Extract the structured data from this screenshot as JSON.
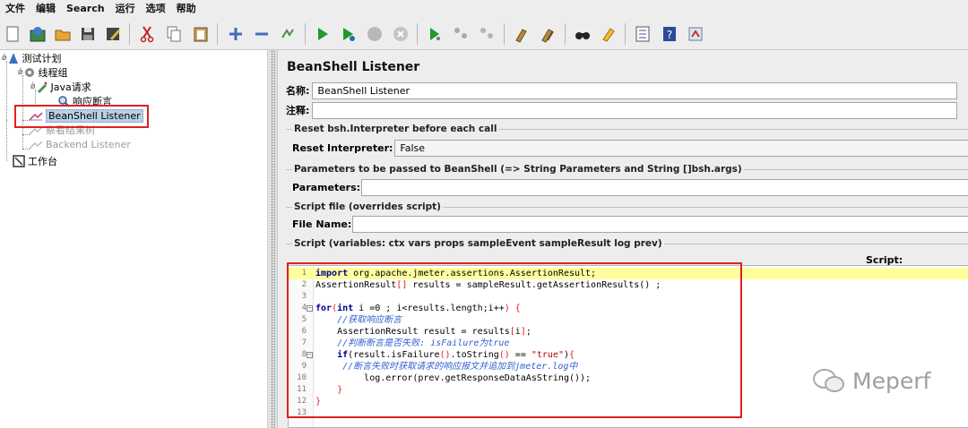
{
  "menu": [
    "文件",
    "编辑",
    "Search",
    "运行",
    "选项",
    "帮助"
  ],
  "toolbar_icons": [
    "new-icon",
    "templates-icon",
    "open-icon",
    "save-icon",
    "save-as-icon",
    "cut-icon",
    "copy-icon",
    "paste-icon",
    "expand-icon",
    "collapse-icon",
    "toggle-icon",
    "start-icon",
    "start-no-pause-icon",
    "stop-icon",
    "shutdown-icon",
    "remote-start-icon",
    "remote-stop-icon",
    "remote-shutdown-icon",
    "clear-icon",
    "clear-all-icon",
    "search-icon",
    "reset-search-icon",
    "function-helper-icon",
    "help-icon",
    "ssl-manager-icon"
  ],
  "tree": {
    "test_plan": "测试计划",
    "thread_group": "线程组",
    "java_request": "Java请求",
    "response_assertion": "响应断言",
    "beanshell_listener": "BeanShell Listener",
    "view_results": "察看结果树",
    "backend_listener": "Backend Listener",
    "workbench": "工作台"
  },
  "panel": {
    "title": "BeanShell Listener",
    "name_label": "名称:",
    "name_value": "BeanShell Listener",
    "comment_label": "注释:",
    "comment_value": "",
    "reset_group_title": "Reset bsh.Interpreter before each call",
    "reset_label": "Reset Interpreter:",
    "reset_value": "False",
    "params_group_title": "Parameters to be passed to BeanShell (=> String Parameters and String []bsh.args)",
    "params_label": "Parameters:",
    "params_value": "",
    "file_group_title": "Script file (overrides script)",
    "file_label": "File Name:",
    "file_value": "",
    "script_group_title": "Script (variables: ctx vars props sampleEvent sampleResult log prev)",
    "script_label": "Script:"
  },
  "code_lines": [
    {
      "n": "1",
      "html": "<span class='kw'>import</span> org.apache.jmeter.assertions.AssertionResult;"
    },
    {
      "n": "2",
      "html": "AssertionResult<span class='br'>[]</span> results = sampleResult.getAssertionResults() ;"
    },
    {
      "n": "3",
      "html": ""
    },
    {
      "n": "4",
      "html": "<span class='kw'>for</span><span class='br'>(</span><span class='kw'>int</span> i =0 ; i&lt;results.length;i++<span class='br'>)</span> <span class='br'>{</span>"
    },
    {
      "n": "5",
      "html": "    <span class='cm'>//获取响应断言</span>"
    },
    {
      "n": "6",
      "html": "    AssertionResult result = results<span class='br'>[</span>i<span class='br'>]</span>;"
    },
    {
      "n": "7",
      "html": "    <span class='cm'>//判断断言是否失败: isFailure为true</span>"
    },
    {
      "n": "8",
      "html": "    <span class='kw'>if</span>(result.isFailure<span class='br'>()</span>.toString<span class='br'>()</span> == <span class='st'>\"true\"</span>)<span class='br'>{</span>"
    },
    {
      "n": "9",
      "html": "     <span class='cm'>//断言失败时获取请求的响应报文并追加到jmeter.log中</span>"
    },
    {
      "n": "10",
      "html": "         log.error(prev.getResponseDataAsString());"
    },
    {
      "n": "11",
      "html": "    <span class='br'>}</span>"
    },
    {
      "n": "12",
      "html": "<span class='br'>}</span>"
    },
    {
      "n": "13",
      "html": ""
    }
  ],
  "watermark": "Meperf",
  "colors": {
    "highlight_box": "#e02020",
    "selection": "#b8cfe5",
    "current_line": "#ffff9e"
  }
}
